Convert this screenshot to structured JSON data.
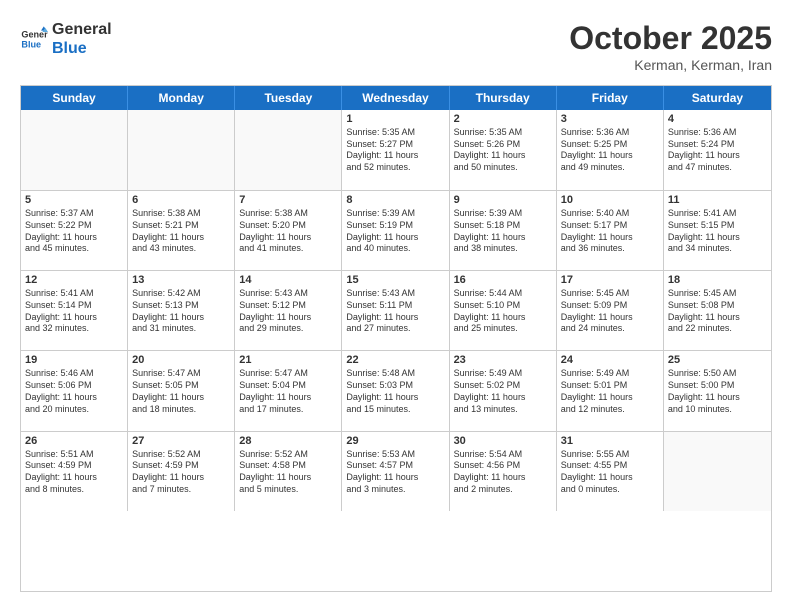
{
  "logo": {
    "line1": "General",
    "line2": "Blue"
  },
  "title": "October 2025",
  "location": "Kerman, Kerman, Iran",
  "days": [
    "Sunday",
    "Monday",
    "Tuesday",
    "Wednesday",
    "Thursday",
    "Friday",
    "Saturday"
  ],
  "weeks": [
    [
      {
        "num": "",
        "info": ""
      },
      {
        "num": "",
        "info": ""
      },
      {
        "num": "",
        "info": ""
      },
      {
        "num": "1",
        "info": "Sunrise: 5:35 AM\nSunset: 5:27 PM\nDaylight: 11 hours\nand 52 minutes."
      },
      {
        "num": "2",
        "info": "Sunrise: 5:35 AM\nSunset: 5:26 PM\nDaylight: 11 hours\nand 50 minutes."
      },
      {
        "num": "3",
        "info": "Sunrise: 5:36 AM\nSunset: 5:25 PM\nDaylight: 11 hours\nand 49 minutes."
      },
      {
        "num": "4",
        "info": "Sunrise: 5:36 AM\nSunset: 5:24 PM\nDaylight: 11 hours\nand 47 minutes."
      }
    ],
    [
      {
        "num": "5",
        "info": "Sunrise: 5:37 AM\nSunset: 5:22 PM\nDaylight: 11 hours\nand 45 minutes."
      },
      {
        "num": "6",
        "info": "Sunrise: 5:38 AM\nSunset: 5:21 PM\nDaylight: 11 hours\nand 43 minutes."
      },
      {
        "num": "7",
        "info": "Sunrise: 5:38 AM\nSunset: 5:20 PM\nDaylight: 11 hours\nand 41 minutes."
      },
      {
        "num": "8",
        "info": "Sunrise: 5:39 AM\nSunset: 5:19 PM\nDaylight: 11 hours\nand 40 minutes."
      },
      {
        "num": "9",
        "info": "Sunrise: 5:39 AM\nSunset: 5:18 PM\nDaylight: 11 hours\nand 38 minutes."
      },
      {
        "num": "10",
        "info": "Sunrise: 5:40 AM\nSunset: 5:17 PM\nDaylight: 11 hours\nand 36 minutes."
      },
      {
        "num": "11",
        "info": "Sunrise: 5:41 AM\nSunset: 5:15 PM\nDaylight: 11 hours\nand 34 minutes."
      }
    ],
    [
      {
        "num": "12",
        "info": "Sunrise: 5:41 AM\nSunset: 5:14 PM\nDaylight: 11 hours\nand 32 minutes."
      },
      {
        "num": "13",
        "info": "Sunrise: 5:42 AM\nSunset: 5:13 PM\nDaylight: 11 hours\nand 31 minutes."
      },
      {
        "num": "14",
        "info": "Sunrise: 5:43 AM\nSunset: 5:12 PM\nDaylight: 11 hours\nand 29 minutes."
      },
      {
        "num": "15",
        "info": "Sunrise: 5:43 AM\nSunset: 5:11 PM\nDaylight: 11 hours\nand 27 minutes."
      },
      {
        "num": "16",
        "info": "Sunrise: 5:44 AM\nSunset: 5:10 PM\nDaylight: 11 hours\nand 25 minutes."
      },
      {
        "num": "17",
        "info": "Sunrise: 5:45 AM\nSunset: 5:09 PM\nDaylight: 11 hours\nand 24 minutes."
      },
      {
        "num": "18",
        "info": "Sunrise: 5:45 AM\nSunset: 5:08 PM\nDaylight: 11 hours\nand 22 minutes."
      }
    ],
    [
      {
        "num": "19",
        "info": "Sunrise: 5:46 AM\nSunset: 5:06 PM\nDaylight: 11 hours\nand 20 minutes."
      },
      {
        "num": "20",
        "info": "Sunrise: 5:47 AM\nSunset: 5:05 PM\nDaylight: 11 hours\nand 18 minutes."
      },
      {
        "num": "21",
        "info": "Sunrise: 5:47 AM\nSunset: 5:04 PM\nDaylight: 11 hours\nand 17 minutes."
      },
      {
        "num": "22",
        "info": "Sunrise: 5:48 AM\nSunset: 5:03 PM\nDaylight: 11 hours\nand 15 minutes."
      },
      {
        "num": "23",
        "info": "Sunrise: 5:49 AM\nSunset: 5:02 PM\nDaylight: 11 hours\nand 13 minutes."
      },
      {
        "num": "24",
        "info": "Sunrise: 5:49 AM\nSunset: 5:01 PM\nDaylight: 11 hours\nand 12 minutes."
      },
      {
        "num": "25",
        "info": "Sunrise: 5:50 AM\nSunset: 5:00 PM\nDaylight: 11 hours\nand 10 minutes."
      }
    ],
    [
      {
        "num": "26",
        "info": "Sunrise: 5:51 AM\nSunset: 4:59 PM\nDaylight: 11 hours\nand 8 minutes."
      },
      {
        "num": "27",
        "info": "Sunrise: 5:52 AM\nSunset: 4:59 PM\nDaylight: 11 hours\nand 7 minutes."
      },
      {
        "num": "28",
        "info": "Sunrise: 5:52 AM\nSunset: 4:58 PM\nDaylight: 11 hours\nand 5 minutes."
      },
      {
        "num": "29",
        "info": "Sunrise: 5:53 AM\nSunset: 4:57 PM\nDaylight: 11 hours\nand 3 minutes."
      },
      {
        "num": "30",
        "info": "Sunrise: 5:54 AM\nSunset: 4:56 PM\nDaylight: 11 hours\nand 2 minutes."
      },
      {
        "num": "31",
        "info": "Sunrise: 5:55 AM\nSunset: 4:55 PM\nDaylight: 11 hours\nand 0 minutes."
      },
      {
        "num": "",
        "info": ""
      }
    ]
  ]
}
